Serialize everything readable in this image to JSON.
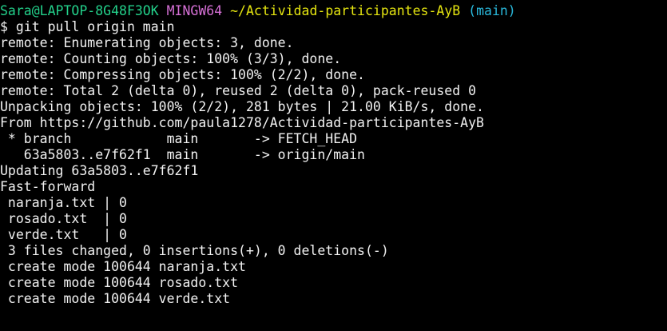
{
  "terminal": {
    "colors": {
      "background": "#000000",
      "text": "#f2f2f2",
      "user": "#23d18b",
      "system": "#d670d6",
      "path": "#e5e510",
      "branch": "#29b8db"
    },
    "prompt": {
      "user_host": "Sara@LAPTOP-8G48F3OK",
      "system": "MINGW64",
      "path": "~/Actividad-participantes-AyB",
      "branch": "(main)"
    },
    "lines": [
      "$ git pull origin main",
      "remote: Enumerating objects: 3, done.",
      "remote: Counting objects: 100% (3/3), done.",
      "remote: Compressing objects: 100% (2/2), done.",
      "remote: Total 2 (delta 0), reused 2 (delta 0), pack-reused 0",
      "Unpacking objects: 100% (2/2), 281 bytes | 21.00 KiB/s, done.",
      "From https://github.com/paula1278/Actividad-participantes-AyB",
      " * branch            main       -> FETCH_HEAD",
      "   63a5803..e7f62f1  main       -> origin/main",
      "Updating 63a5803..e7f62f1",
      "Fast-forward",
      " naranja.txt | 0",
      " rosado.txt  | 0",
      " verde.txt   | 0",
      " 3 files changed, 0 insertions(+), 0 deletions(-)",
      " create mode 100644 naranja.txt",
      " create mode 100644 rosado.txt",
      " create mode 100644 verde.txt"
    ]
  }
}
